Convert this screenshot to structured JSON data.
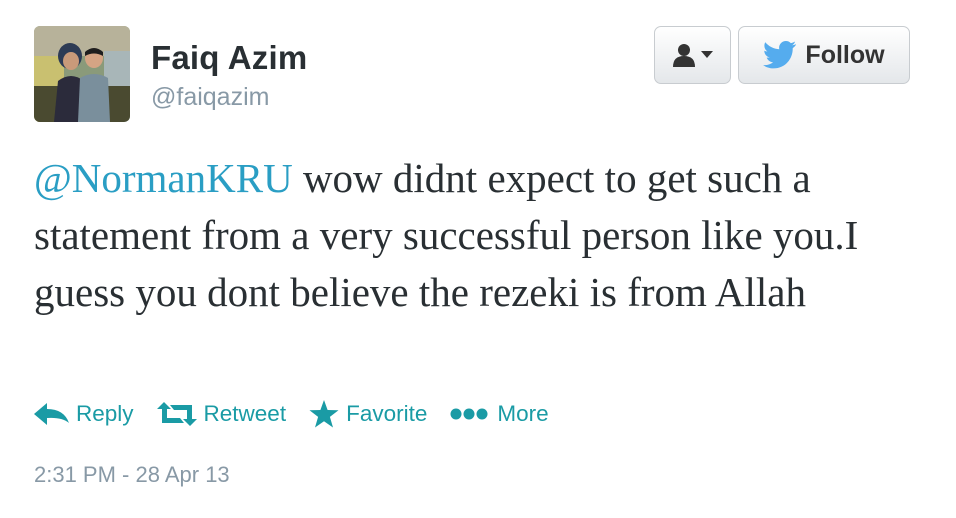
{
  "user": {
    "name": "Faiq Azim",
    "handle": "@faiqazim"
  },
  "buttons": {
    "follow_label": "Follow"
  },
  "tweet": {
    "mention": "@NormanKRU",
    "text": " wow didnt expect to get such a statement from a very successful person like you.I guess you dont believe the rezeki is from Allah"
  },
  "actions": {
    "reply": "Reply",
    "retweet": "Retweet",
    "favorite": "Favorite",
    "more": "More"
  },
  "timestamp": "2:31 PM - 28 Apr 13",
  "colors": {
    "link": "#2a9ec4",
    "action": "#1a9ba5",
    "twitter_bird": "#55acee",
    "muted": "#8899a6"
  },
  "icons": [
    "user-icon",
    "caret-down-icon",
    "twitter-bird-icon",
    "reply-icon",
    "retweet-icon",
    "star-icon",
    "more-dots-icon"
  ]
}
